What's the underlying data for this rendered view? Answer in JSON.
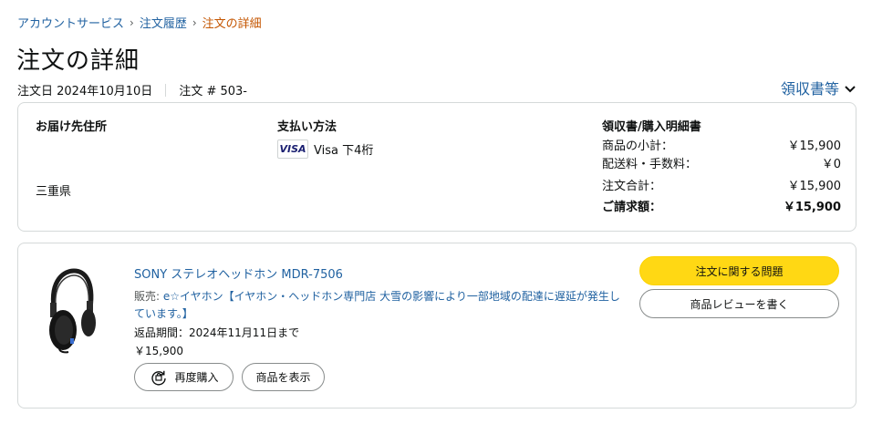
{
  "breadcrumb": {
    "items": [
      {
        "label": "アカウントサービス"
      },
      {
        "label": "注文履歴"
      },
      {
        "label": "注文の詳細"
      }
    ],
    "separator": "›"
  },
  "page_title": "注文の詳細",
  "order_meta": {
    "date": "注文日 2024年10月10日",
    "order_no": "注文 # 503-"
  },
  "receipts_link": "領収書等",
  "shipping": {
    "title": "お届け先住所",
    "prefecture": "三重県"
  },
  "payment": {
    "title": "支払い方法",
    "card_brand": "VISA",
    "card_text": "Visa 下4桁"
  },
  "summary": {
    "title": "領収書/購入明細書",
    "rows": [
      {
        "label": "商品の小計：",
        "value": "￥15,900"
      },
      {
        "label": "配送料・手数料：",
        "value": "￥0"
      },
      {
        "label": "注文合計：",
        "value": "￥15,900"
      },
      {
        "label": "ご請求額：",
        "value": "￥15,900"
      }
    ]
  },
  "item": {
    "title": "SONY ステレオヘッドホン MDR-7506",
    "seller_prefix": "販売: ",
    "seller_name": "e☆イヤホン【イヤホン・ヘッドホン専門店 大雪の影響により一部地域の配達に遅延が発生しています。】",
    "return_period": "返品期間：2024年11月11日まで",
    "price": "￥15,900",
    "image_icon": "headphones-image"
  },
  "buttons": {
    "rebuy": "再度購入",
    "view_item": "商品を表示",
    "order_issue": "注文に関する問題",
    "write_review": "商品レビューを書く"
  },
  "colors": {
    "link": "#2162a1",
    "breadcrumb_current": "#c45500",
    "primary_button": "#ffd814",
    "border": "#d5d9d9"
  }
}
